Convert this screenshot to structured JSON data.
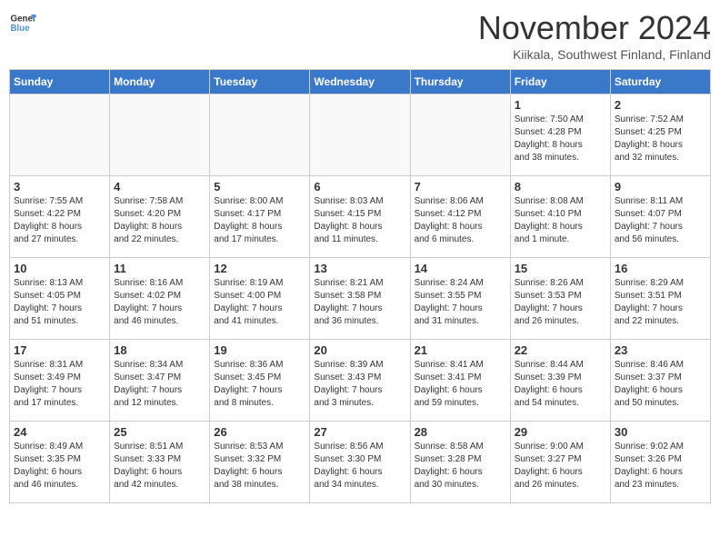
{
  "header": {
    "logo_line1": "General",
    "logo_line2": "Blue",
    "month_title": "November 2024",
    "location": "Kiikala, Southwest Finland, Finland"
  },
  "weekdays": [
    "Sunday",
    "Monday",
    "Tuesday",
    "Wednesday",
    "Thursday",
    "Friday",
    "Saturday"
  ],
  "weeks": [
    [
      {
        "day": "",
        "info": ""
      },
      {
        "day": "",
        "info": ""
      },
      {
        "day": "",
        "info": ""
      },
      {
        "day": "",
        "info": ""
      },
      {
        "day": "",
        "info": ""
      },
      {
        "day": "1",
        "info": "Sunrise: 7:50 AM\nSunset: 4:28 PM\nDaylight: 8 hours\nand 38 minutes."
      },
      {
        "day": "2",
        "info": "Sunrise: 7:52 AM\nSunset: 4:25 PM\nDaylight: 8 hours\nand 32 minutes."
      }
    ],
    [
      {
        "day": "3",
        "info": "Sunrise: 7:55 AM\nSunset: 4:22 PM\nDaylight: 8 hours\nand 27 minutes."
      },
      {
        "day": "4",
        "info": "Sunrise: 7:58 AM\nSunset: 4:20 PM\nDaylight: 8 hours\nand 22 minutes."
      },
      {
        "day": "5",
        "info": "Sunrise: 8:00 AM\nSunset: 4:17 PM\nDaylight: 8 hours\nand 17 minutes."
      },
      {
        "day": "6",
        "info": "Sunrise: 8:03 AM\nSunset: 4:15 PM\nDaylight: 8 hours\nand 11 minutes."
      },
      {
        "day": "7",
        "info": "Sunrise: 8:06 AM\nSunset: 4:12 PM\nDaylight: 8 hours\nand 6 minutes."
      },
      {
        "day": "8",
        "info": "Sunrise: 8:08 AM\nSunset: 4:10 PM\nDaylight: 8 hours\nand 1 minute."
      },
      {
        "day": "9",
        "info": "Sunrise: 8:11 AM\nSunset: 4:07 PM\nDaylight: 7 hours\nand 56 minutes."
      }
    ],
    [
      {
        "day": "10",
        "info": "Sunrise: 8:13 AM\nSunset: 4:05 PM\nDaylight: 7 hours\nand 51 minutes."
      },
      {
        "day": "11",
        "info": "Sunrise: 8:16 AM\nSunset: 4:02 PM\nDaylight: 7 hours\nand 46 minutes."
      },
      {
        "day": "12",
        "info": "Sunrise: 8:19 AM\nSunset: 4:00 PM\nDaylight: 7 hours\nand 41 minutes."
      },
      {
        "day": "13",
        "info": "Sunrise: 8:21 AM\nSunset: 3:58 PM\nDaylight: 7 hours\nand 36 minutes."
      },
      {
        "day": "14",
        "info": "Sunrise: 8:24 AM\nSunset: 3:55 PM\nDaylight: 7 hours\nand 31 minutes."
      },
      {
        "day": "15",
        "info": "Sunrise: 8:26 AM\nSunset: 3:53 PM\nDaylight: 7 hours\nand 26 minutes."
      },
      {
        "day": "16",
        "info": "Sunrise: 8:29 AM\nSunset: 3:51 PM\nDaylight: 7 hours\nand 22 minutes."
      }
    ],
    [
      {
        "day": "17",
        "info": "Sunrise: 8:31 AM\nSunset: 3:49 PM\nDaylight: 7 hours\nand 17 minutes."
      },
      {
        "day": "18",
        "info": "Sunrise: 8:34 AM\nSunset: 3:47 PM\nDaylight: 7 hours\nand 12 minutes."
      },
      {
        "day": "19",
        "info": "Sunrise: 8:36 AM\nSunset: 3:45 PM\nDaylight: 7 hours\nand 8 minutes."
      },
      {
        "day": "20",
        "info": "Sunrise: 8:39 AM\nSunset: 3:43 PM\nDaylight: 7 hours\nand 3 minutes."
      },
      {
        "day": "21",
        "info": "Sunrise: 8:41 AM\nSunset: 3:41 PM\nDaylight: 6 hours\nand 59 minutes."
      },
      {
        "day": "22",
        "info": "Sunrise: 8:44 AM\nSunset: 3:39 PM\nDaylight: 6 hours\nand 54 minutes."
      },
      {
        "day": "23",
        "info": "Sunrise: 8:46 AM\nSunset: 3:37 PM\nDaylight: 6 hours\nand 50 minutes."
      }
    ],
    [
      {
        "day": "24",
        "info": "Sunrise: 8:49 AM\nSunset: 3:35 PM\nDaylight: 6 hours\nand 46 minutes."
      },
      {
        "day": "25",
        "info": "Sunrise: 8:51 AM\nSunset: 3:33 PM\nDaylight: 6 hours\nand 42 minutes."
      },
      {
        "day": "26",
        "info": "Sunrise: 8:53 AM\nSunset: 3:32 PM\nDaylight: 6 hours\nand 38 minutes."
      },
      {
        "day": "27",
        "info": "Sunrise: 8:56 AM\nSunset: 3:30 PM\nDaylight: 6 hours\nand 34 minutes."
      },
      {
        "day": "28",
        "info": "Sunrise: 8:58 AM\nSunset: 3:28 PM\nDaylight: 6 hours\nand 30 minutes."
      },
      {
        "day": "29",
        "info": "Sunrise: 9:00 AM\nSunset: 3:27 PM\nDaylight: 6 hours\nand 26 minutes."
      },
      {
        "day": "30",
        "info": "Sunrise: 9:02 AM\nSunset: 3:26 PM\nDaylight: 6 hours\nand 23 minutes."
      }
    ]
  ]
}
